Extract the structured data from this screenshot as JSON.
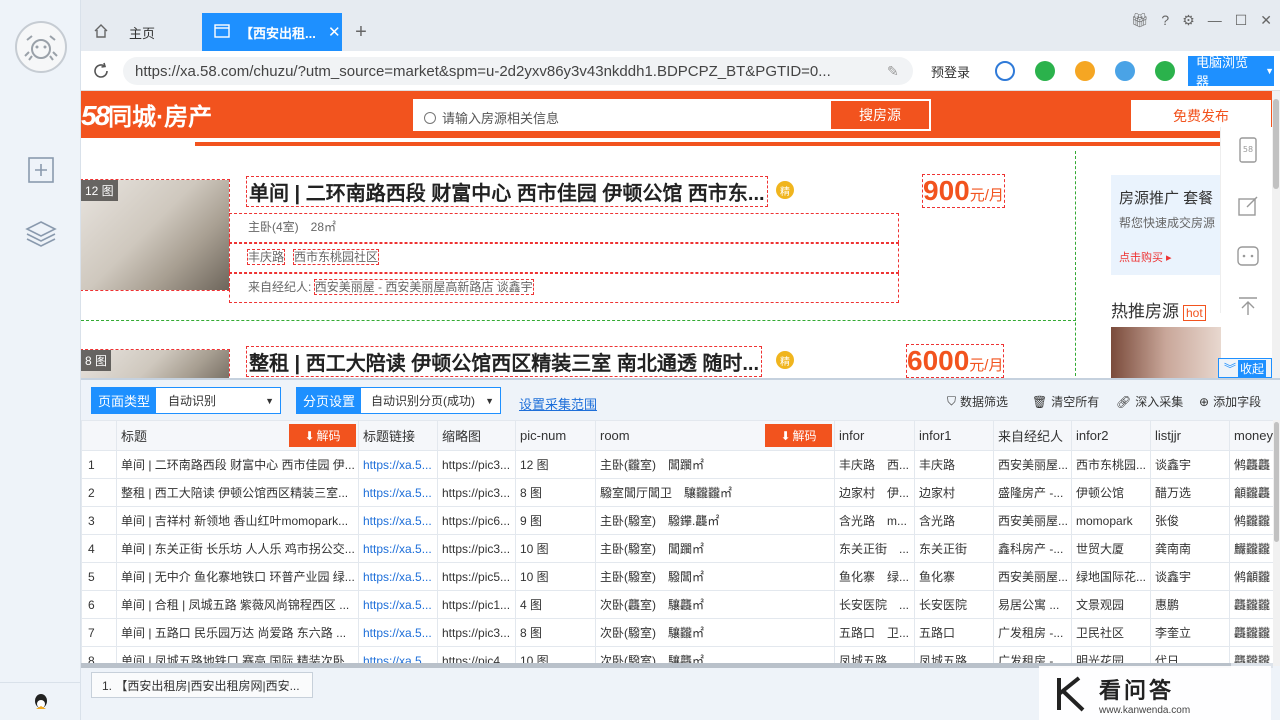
{
  "tabs": {
    "home_label": "主页",
    "active_label": "【西安出租..."
  },
  "address": {
    "url": "https://xa.58.com/chuzu/?utm_source=market&spm=u-2d2yxv86y3v43nkddh1.BDPCPZ_BT&PGTID=0...",
    "login_label": "预登录",
    "browser_label": "电脑浏览器"
  },
  "site": {
    "logo_num": "58",
    "logo_text": "同城·房产",
    "search_placeholder": "请输入房源相关信息",
    "search_button": "搜房源",
    "publish_button": "免费发布",
    "accent": "#f2531e"
  },
  "listings": [
    {
      "photo_count": "12 图",
      "title": "单间 | 二环南路西段 财富中心 西市佳园 伊顿公馆 西市东...",
      "price": "900",
      "price_unit": "元/月",
      "room": "主卧(4室)　28㎡",
      "addr1": "丰庆路",
      "addr2": "西市东桃园社区",
      "agent_label": "来自经纪人:",
      "agent": "西安美丽屋 - 西安美丽屋高新路店 谈鑫宇"
    },
    {
      "photo_count": "8 图",
      "title": "整租 | 西工大陪读 伊顿公馆西区精装三室 南北通透 随时...",
      "price": "6000",
      "price_unit": "元/月"
    }
  ],
  "promo": {
    "title": "房源推广 套餐",
    "subtitle": "帮您快速成交房源",
    "link": "点击购买 ▸"
  },
  "hot": {
    "title": "热推房源",
    "badge": "hot"
  },
  "floatbar": {
    "badge_58": "58",
    "collapse": "收起"
  },
  "toolbar": {
    "page_type_label": "页面类型",
    "page_type_value": "自动识别",
    "paging_label": "分页设置",
    "paging_value": "自动识别分页(成功)",
    "range_link": "设置采集范围",
    "filter": "数据筛选",
    "clear": "清空所有",
    "deep": "深入采集",
    "add_field": "添加字段"
  },
  "table": {
    "decode_label": "解码",
    "columns": [
      "",
      "标题",
      "标题链接",
      "缩略图",
      "pic-num",
      "room",
      "infor",
      "infor1",
      "来自经纪人",
      "infor2",
      "listjjr",
      "money"
    ],
    "rows": [
      [
        "1",
        "单间 | 二环南路西段 财富中心 西市佳园 伊...",
        "https://xa.5...",
        "https://pic3...",
        "12 图",
        "主卧(龖室)　閶躙㎡",
        "丰庆路　西...",
        "丰庆路",
        "西安美丽屋...",
        "西市东桃园...",
        "谈鑫宇",
        "鸺龘龘"
      ],
      [
        "2",
        "整租 | 西工大陪读 伊顿公馆西区精装三室...",
        "https://xa.5...",
        "https://pic3...",
        "8 图",
        "驋室閶厅閶卫　驤龖龖㎡",
        "边家村　伊...",
        "边家村",
        "盛隆房产 -...",
        "伊顿公馆",
        "醋万选",
        "龥龖龘"
      ],
      [
        "3",
        "单间 | 吉祥村 新领地 香山红叶momopark...",
        "https://xa.5...",
        "https://pic6...",
        "9 图",
        "主卧(驋室)　驋鑻.龘㎡",
        "含光路　m...",
        "含光路",
        "西安美丽屋...",
        "momopark",
        "张俊",
        "鸺龖龖"
      ],
      [
        "4",
        "单间 | 东关正街 长乐坊 人人乐 鸡市拐公交...",
        "https://xa.5...",
        "https://pic3...",
        "10 图",
        "主卧(驋室)　閶躙㎡",
        "东关正街　...",
        "东关正街",
        "鑫科房产 -...",
        "世贸大厦",
        "龚南南",
        "麣龖龖"
      ],
      [
        "5",
        "单间 | 无中介 鱼化寨地铁口 环普产业园 绿...",
        "https://xa.5...",
        "https://pic5...",
        "10 图",
        "主卧(驋室)　驋閶㎡",
        "鱼化寨　绿...",
        "鱼化寨",
        "西安美丽屋...",
        "绿地国际花...",
        "谈鑫宇",
        "鸺龥龖"
      ],
      [
        "6",
        "单间 | 合租 | 凤城五路 紫薇风尚锦程西区 ...",
        "https://xa.5...",
        "https://pic1...",
        "4 图",
        "次卧(龘室)　驤龘㎡",
        "长安医院　...",
        "长安医院",
        "易居公寓 ...",
        "文景观园",
        "惠鹏",
        "龘龖龖"
      ],
      [
        "7",
        "单间 | 五路口 民乐园万达 尚爱路 东六路 ...",
        "https://xa.5...",
        "https://pic3...",
        "8 图",
        "次卧(驋室)　驤龖㎡",
        "五路口　卫...",
        "五路口",
        "广发租房 -...",
        "卫民社区",
        "李奎立",
        "龘龖龖"
      ],
      [
        "8",
        "单间 | 凤城五路地铁口 赛高 国际 精装次卧...",
        "https://xa.5...",
        "https://pic4...",
        "10 图",
        "次卧(驋室)　驤龘㎡",
        "凤城五路　...",
        "凤城五路",
        "广发租房 -...",
        "明光花园",
        "代日",
        "龘龖龖"
      ]
    ]
  },
  "bottom_tab": "1. 【西安出租房|西安出租房网|西安...",
  "watermark": {
    "title": "看问答",
    "url": "www.kanwenda.com"
  }
}
